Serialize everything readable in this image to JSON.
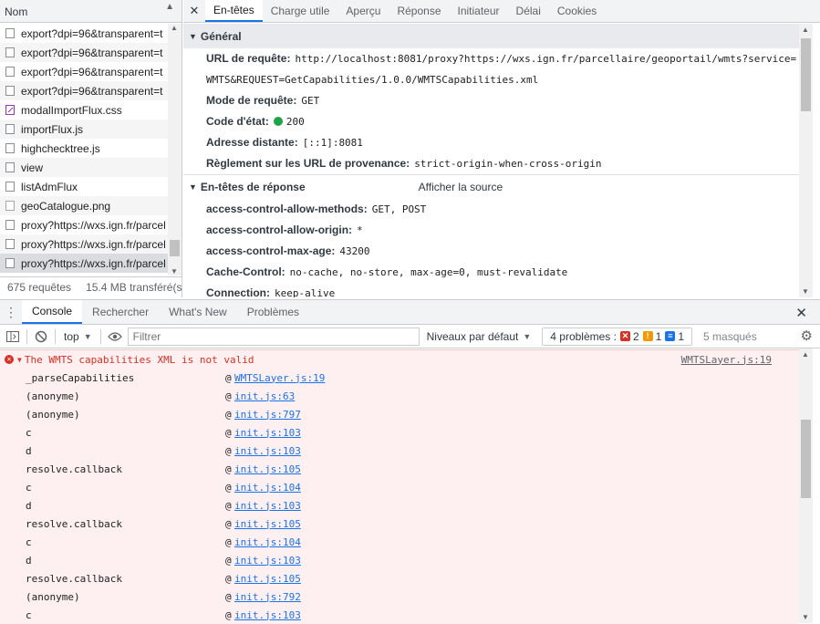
{
  "network": {
    "column_header": "Nom",
    "files": [
      {
        "name": "export?dpi=96&transparent=t",
        "icon": "doc-icon"
      },
      {
        "name": "export?dpi=96&transparent=t",
        "icon": "doc-icon"
      },
      {
        "name": "export?dpi=96&transparent=t",
        "icon": "doc-icon"
      },
      {
        "name": "export?dpi=96&transparent=t",
        "icon": "doc-icon"
      },
      {
        "name": "modalImportFlux.css",
        "icon": "css-file-icon"
      },
      {
        "name": "importFlux.js",
        "icon": "doc-icon"
      },
      {
        "name": "highchecktree.js",
        "icon": "doc-icon"
      },
      {
        "name": "view",
        "icon": "doc-icon"
      },
      {
        "name": "listAdmFlux",
        "icon": "doc-icon"
      },
      {
        "name": "geoCatalogue.png",
        "icon": "image-file-icon"
      },
      {
        "name": "proxy?https://wxs.ign.fr/parcel",
        "icon": "doc-icon"
      },
      {
        "name": "proxy?https://wxs.ign.fr/parcel",
        "icon": "doc-icon"
      },
      {
        "name": "proxy?https://wxs.ign.fr/parcel",
        "icon": "doc-icon"
      }
    ],
    "requests": "675 requêtes",
    "transferred": "15.4 MB transféré(s"
  },
  "detail": {
    "tabs": [
      "En-têtes",
      "Charge utile",
      "Aperçu",
      "Réponse",
      "Initiateur",
      "Délai",
      "Cookies"
    ],
    "active_tab": "En-têtes",
    "general": {
      "title": "Général",
      "url_label": "URL de requête:",
      "url_value_1": "http://localhost:8081/proxy?https://wxs.ign.fr/parcellaire/geoportail/wmts?service=",
      "url_value_2": "WMTS&REQUEST=GetCapabilities/1.0.0/WMTSCapabilities.xml",
      "method_label": "Mode de requête:",
      "method_value": "GET",
      "status_label": "Code d'état:",
      "status_value": "200",
      "remote_label": "Adresse distante:",
      "remote_value": "[::1]:8081",
      "referrer_label": "Règlement sur les URL de provenance:",
      "referrer_value": "strict-origin-when-cross-origin"
    },
    "response_headers": {
      "title": "En-têtes de réponse",
      "view_source": "Afficher la source",
      "items": [
        {
          "k": "access-control-allow-methods:",
          "v": "GET, POST"
        },
        {
          "k": "access-control-allow-origin:",
          "v": "*"
        },
        {
          "k": "access-control-max-age:",
          "v": "43200"
        },
        {
          "k": "Cache-Control:",
          "v": "no-cache, no-store, max-age=0, must-revalidate"
        },
        {
          "k": "Connection:",
          "v": "keep-alive"
        }
      ]
    }
  },
  "drawer": {
    "tabs": [
      "Console",
      "Rechercher",
      "What's New",
      "Problèmes"
    ],
    "active_tab": "Console",
    "context": "top",
    "filter_placeholder": "Filtrer",
    "levels": "Niveaux par défaut",
    "problems_label": "4 problèmes :",
    "problems_err": "2",
    "problems_warn": "1",
    "problems_info": "1",
    "masked": "5 masqués"
  },
  "console": {
    "error_message": "The WMTS capabilities XML is not valid",
    "error_source": "WMTSLayer.js:19",
    "stack": [
      {
        "fn": "_parseCapabilities",
        "loc": "WMTSLayer.js:19"
      },
      {
        "fn": "(anonyme)",
        "loc": "init.js:63"
      },
      {
        "fn": "(anonyme)",
        "loc": "init.js:797"
      },
      {
        "fn": "c",
        "loc": "init.js:103"
      },
      {
        "fn": "d",
        "loc": "init.js:103"
      },
      {
        "fn": "resolve.callback",
        "loc": "init.js:105"
      },
      {
        "fn": "c",
        "loc": "init.js:104"
      },
      {
        "fn": "d",
        "loc": "init.js:103"
      },
      {
        "fn": "resolve.callback",
        "loc": "init.js:105"
      },
      {
        "fn": "c",
        "loc": "init.js:104"
      },
      {
        "fn": "d",
        "loc": "init.js:103"
      },
      {
        "fn": "resolve.callback",
        "loc": "init.js:105"
      },
      {
        "fn": "(anonyme)",
        "loc": "init.js:792"
      },
      {
        "fn": "c",
        "loc": "init.js:103"
      }
    ]
  },
  "colors": {
    "accent": "#1a73e8",
    "error": "#d93025",
    "error_bg": "#fef0f0",
    "status_ok": "#1ea446"
  }
}
